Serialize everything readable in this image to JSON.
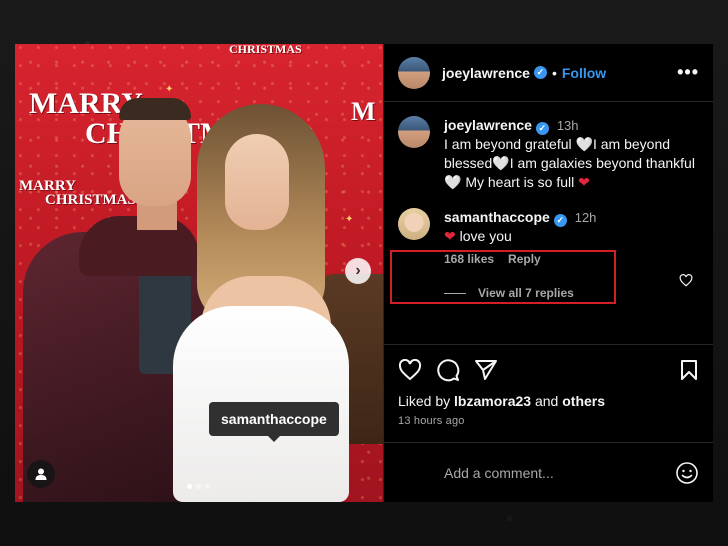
{
  "photo": {
    "backdrop_texts": {
      "marry_big": "MARRY",
      "christmas_big": "CHRISTMAS",
      "marry_small": "MARRY",
      "christmas_small": "CHRISTMAS",
      "christmas_top": "CHRISTMAS",
      "m_right": "M",
      "m_mid": "M"
    },
    "tag_label": "samanthaccope",
    "carousel": {
      "current": 1,
      "total": 3
    }
  },
  "header": {
    "username": "joeylawrence",
    "separator": "•",
    "follow_label": "Follow",
    "more_label": "•••"
  },
  "caption": {
    "username": "joeylawrence",
    "time": "13h",
    "text_part1": "I am beyond grateful ",
    "text_part2": "I am beyond blessed",
    "text_part3": "I am galaxies beyond thankful ",
    "text_part4": " My heart is so full ",
    "white_heart": "🤍",
    "red_heart": "❤"
  },
  "comment": {
    "username": "samanthaccope",
    "time": "12h",
    "heart": "❤",
    "text": " love you",
    "likes": "168 likes",
    "reply_label": "Reply",
    "view_replies": "View all 7 replies"
  },
  "post": {
    "liked_prefix": "Liked by ",
    "liked_user": "lbzamora23",
    "liked_and": " and ",
    "liked_others": "others",
    "time_ago": "13 hours ago"
  },
  "composer": {
    "placeholder": "Add a comment..."
  },
  "icons": {
    "verified": "verified-badge-icon",
    "like": "heart-outline-icon",
    "comment": "comment-bubble-icon",
    "share": "paper-plane-icon",
    "save": "bookmark-icon",
    "emoji": "smiley-icon",
    "next": "chevron-right-icon",
    "tags": "user-tag-icon"
  },
  "colors": {
    "link_blue": "#3897f0",
    "highlight_red": "#d11f25",
    "backdrop_red": "#c91f2a",
    "heart_red": "#e0263a"
  }
}
